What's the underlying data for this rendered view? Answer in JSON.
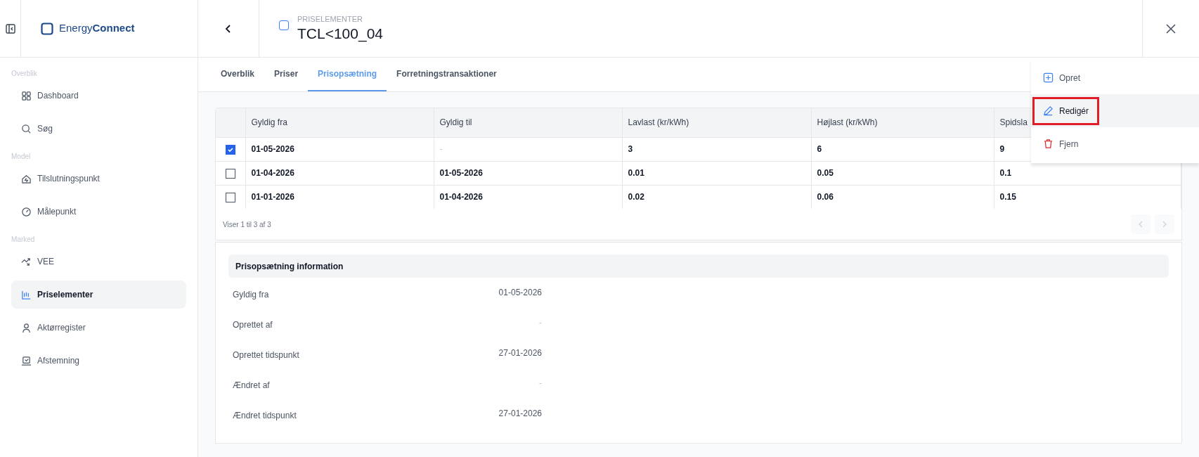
{
  "brand": {
    "name_light": "Energy",
    "name_bold": "Connect"
  },
  "header": {
    "breadcrumb": "PRISELEMENTER",
    "title": "TCL<100_04",
    "checked": false
  },
  "sidebar": {
    "sections": [
      {
        "label": "Overblik",
        "items": [
          {
            "label": "Dashboard",
            "selected": false
          },
          {
            "label": "Søg",
            "selected": false
          }
        ]
      },
      {
        "label": "Model",
        "items": [
          {
            "label": "Tilslutningspunkt",
            "selected": false
          },
          {
            "label": "Målepunkt",
            "selected": false
          }
        ]
      },
      {
        "label": "Marked",
        "items": [
          {
            "label": "VEE",
            "selected": false
          },
          {
            "label": "Priselementer",
            "selected": true
          },
          {
            "label": "Aktørregister",
            "selected": false
          },
          {
            "label": "Afstemning",
            "selected": false
          }
        ]
      }
    ]
  },
  "tabs": [
    {
      "label": "Overblik",
      "selected": false
    },
    {
      "label": "Priser",
      "selected": false
    },
    {
      "label": "Prisopsætning",
      "selected": true
    },
    {
      "label": "Forretningstransaktioner",
      "selected": false
    }
  ],
  "table": {
    "columns": [
      "Gyldig fra",
      "Gyldig til",
      "Lavlast (kr/kWh)",
      "Højlast (kr/kWh)",
      "Spidsla"
    ],
    "rows": [
      {
        "checked": true,
        "cells": [
          "01-05-2026",
          "-",
          "3",
          "6",
          "9"
        ]
      },
      {
        "checked": false,
        "cells": [
          "01-04-2026",
          "01-05-2026",
          "0.01",
          "0.05",
          "0.1"
        ]
      },
      {
        "checked": false,
        "cells": [
          "01-01-2026",
          "01-04-2026",
          "0.02",
          "0.06",
          "0.15"
        ]
      }
    ],
    "footer": "Viser 1 til 3 af 3",
    "prev_disabled": true,
    "next_disabled": true
  },
  "info": {
    "title": "Prisopsætning information",
    "fields": [
      {
        "label": "Gyldig fra",
        "value": "01-05-2026"
      },
      {
        "label": "Oprettet af",
        "value": "-"
      },
      {
        "label": "Oprettet tidspunkt",
        "value": "27-01-2026"
      },
      {
        "label": "Ændret af",
        "value": "-"
      },
      {
        "label": "Ændret tidspunkt",
        "value": "27-01-2026"
      }
    ]
  },
  "menu": [
    {
      "kind": "create",
      "label": "Opret",
      "highlighted": false
    },
    {
      "kind": "edit",
      "label": "Redigér",
      "highlighted": true
    },
    {
      "kind": "delete",
      "label": "Fjern",
      "highlighted": false
    }
  ]
}
